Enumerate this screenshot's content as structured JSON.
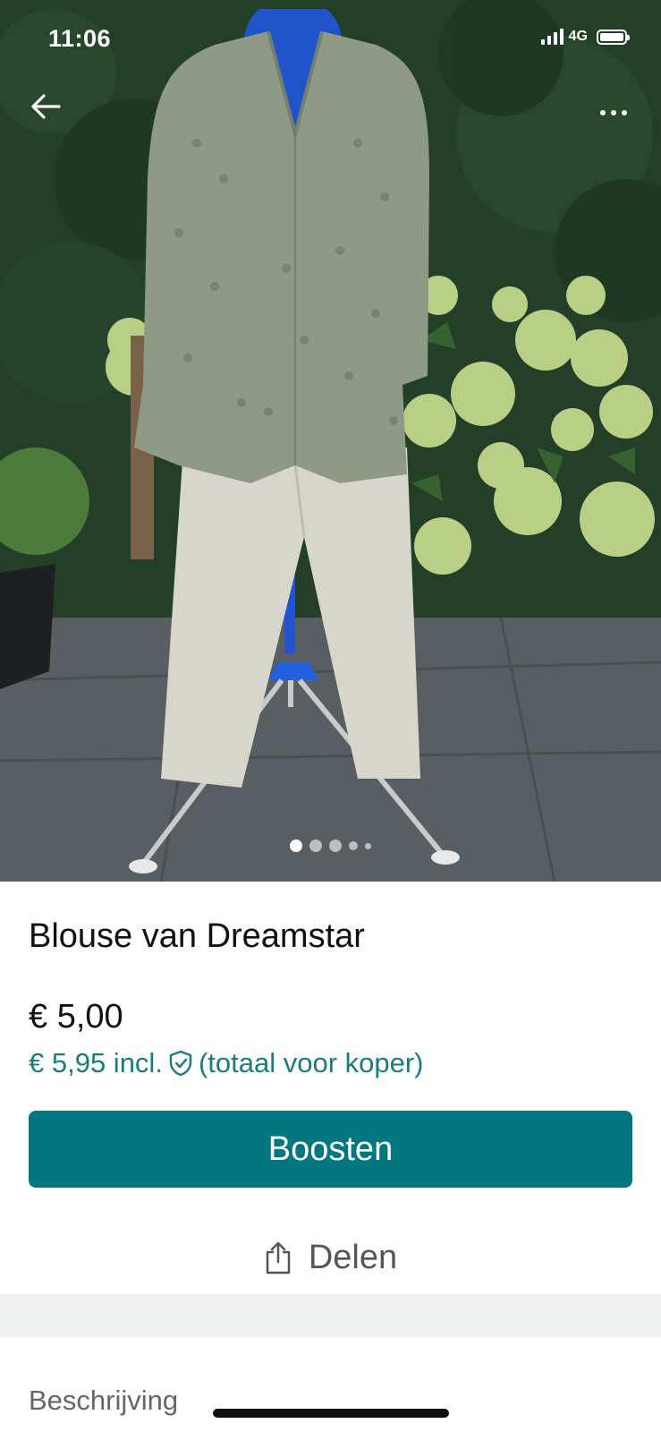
{
  "status_bar": {
    "time": "11:06",
    "network": "4G"
  },
  "photo": {
    "slide_count": 5,
    "active_slide": 1
  },
  "nav": {
    "back_icon": "arrow-left-icon",
    "more_icon": "more-horizontal-icon"
  },
  "listing": {
    "title": "Blouse van Dreamstar",
    "price": "€ 5,00",
    "price_incl": "€ 5,95 incl.",
    "price_incl_suffix": "(totaal voor koper)",
    "protection_icon": "shield-check-icon"
  },
  "actions": {
    "boost_label": "Boosten",
    "share_label": "Delen",
    "share_icon": "share-icon"
  },
  "description": {
    "label": "Beschrijving"
  },
  "colors": {
    "primary": "#037780",
    "price_incl_text": "#1a7c7f",
    "divider": "#eef0f0"
  }
}
